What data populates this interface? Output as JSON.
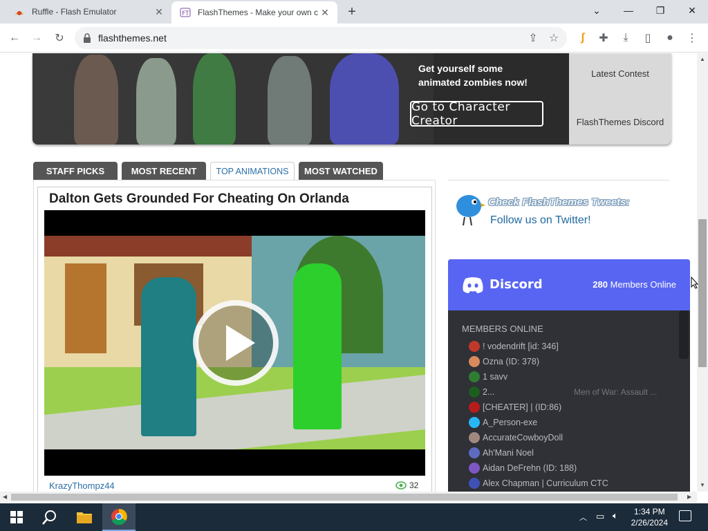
{
  "browser": {
    "tabs": [
      {
        "title": "Ruffle - Flash Emulator",
        "active": false
      },
      {
        "title": "FlashThemes - Make your own ca",
        "active": true
      }
    ],
    "new_tab": "+",
    "url": "flashthemes.net"
  },
  "banner": {
    "promo_line1": "Get yourself some",
    "promo_line2": "animated zombies now!",
    "cta": "Go to Character Creator",
    "side_links": [
      "Latest Contest",
      "FlashThemes Discord"
    ]
  },
  "content_tabs": [
    "STAFF PICKS",
    "MOST RECENT",
    "TOP ANIMATIONS",
    "MOST WATCHED"
  ],
  "active_tab": "TOP ANIMATIONS",
  "video": {
    "title": "Dalton Gets Grounded For Cheating On Orlanda",
    "author": "KrazyThompz44",
    "views": "32"
  },
  "twitter": {
    "headline": "Check FlashThemes Tweets:",
    "cta": "Follow us on Twitter!"
  },
  "discord": {
    "brand": "Discord",
    "online_count": "280",
    "online_label": "Members Online",
    "section": "MEMBERS ONLINE",
    "members": [
      {
        "name": "! vodendrift [id: 346]",
        "color": "#c0392b",
        "game": ""
      },
      {
        "name": "Ozna (ID: 378)",
        "color": "#d98a5c",
        "game": ""
      },
      {
        "name": "1 savv",
        "color": "#2e7d32",
        "game": ""
      },
      {
        "name": "2...",
        "color": "#1b5e20",
        "game": "Men of War: Assault ..."
      },
      {
        "name": "[CHEATER] | (ID:86)",
        "color": "#b71c1c",
        "game": ""
      },
      {
        "name": "A_Person-exe",
        "color": "#29b6f6",
        "game": ""
      },
      {
        "name": "AccurateCowboyDoll",
        "color": "#a1887f",
        "game": ""
      },
      {
        "name": "Ah'Mani Noel",
        "color": "#5c6bc0",
        "game": ""
      },
      {
        "name": "Aidan DeFrehn (ID: 188)",
        "color": "#7e57c2",
        "game": ""
      },
      {
        "name": "Alex Chapman | Curriculum CTC",
        "color": "#3f51b5",
        "game": ""
      }
    ]
  },
  "taskbar": {
    "time": "1:34 PM",
    "date": "2/26/2024"
  }
}
